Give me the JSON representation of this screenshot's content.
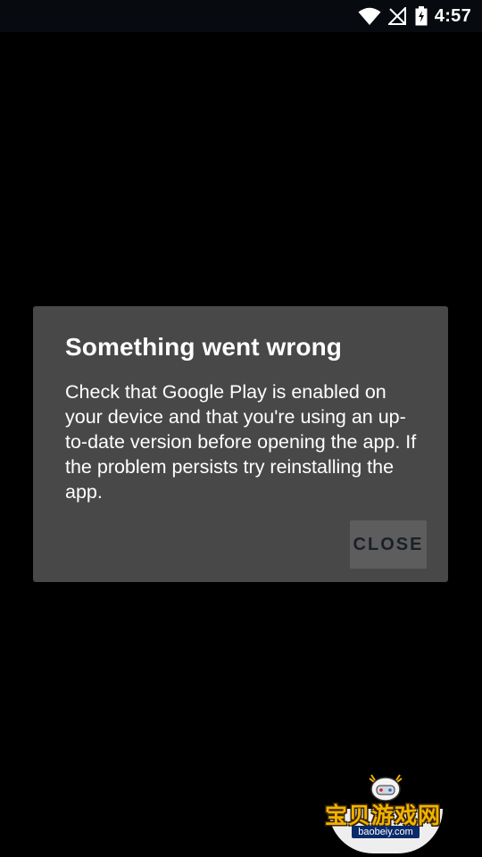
{
  "status_bar": {
    "time": "4:57",
    "icons": [
      "wifi-icon",
      "no-signal-icon",
      "battery-charging-icon"
    ]
  },
  "dialog": {
    "title": "Something went wrong",
    "message": "Check that Google Play is enabled on your device and that you're using an up-to-date version before opening the app. If the problem persists try reinstalling the app.",
    "close_label": "CLOSE"
  },
  "watermark": {
    "text": "宝贝游戏网",
    "url": "baobeiy.com"
  },
  "colors": {
    "background": "#000000",
    "dialog_background": "#484848",
    "button_background": "#5d5d5d",
    "button_text": "#1b1f28",
    "watermark_text": "#f2b200"
  }
}
